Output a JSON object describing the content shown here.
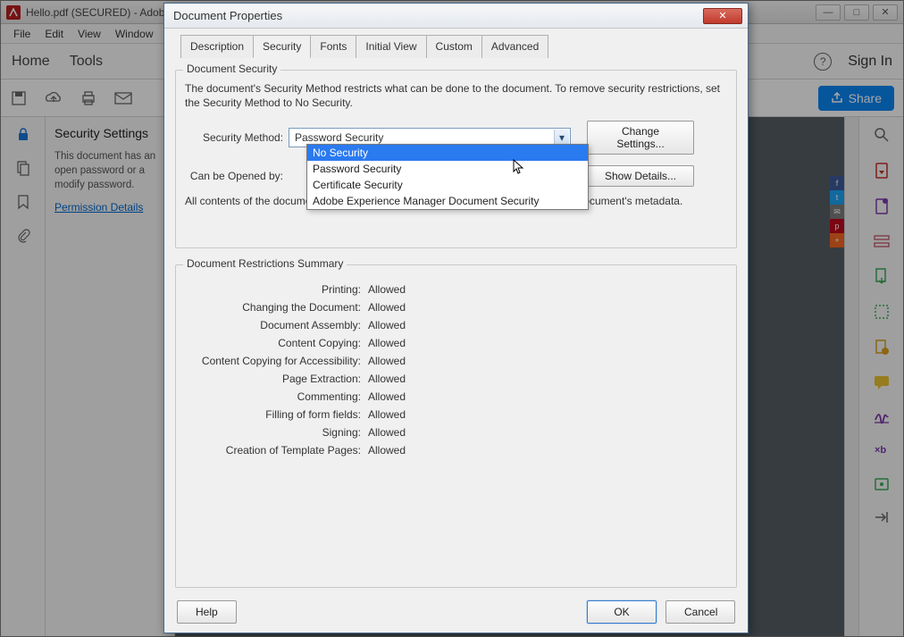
{
  "app": {
    "title": "Hello.pdf (SECURED) - Adob…",
    "menubar": [
      "File",
      "Edit",
      "View",
      "Window"
    ],
    "tabs": {
      "home": "Home",
      "tools": "Tools"
    },
    "help_glyph": "?",
    "signin": "Sign In",
    "share": "Share"
  },
  "leftpanel": {
    "heading": "Security Settings",
    "desc": "This document has an open password or a modify password.",
    "link": "Permission Details"
  },
  "dialog": {
    "title": "Document Properties",
    "tabs": [
      "Description",
      "Security",
      "Fonts",
      "Initial View",
      "Custom",
      "Advanced"
    ],
    "active_tab": 1,
    "security": {
      "group_label": "Document Security",
      "intro": "The document's Security Method restricts what can be done to the document. To remove security restrictions, set the Security Method to No Security.",
      "method_label": "Security Method:",
      "method_value": "Password Security",
      "method_options": [
        "No Security",
        "Password Security",
        "Certificate Security",
        "Adobe Experience Manager Document Security"
      ],
      "method_selected_index": 0,
      "change_settings": "Change Settings...",
      "opened_by_label": "Can be Opened by:",
      "show_details": "Show Details...",
      "contents_note": "All contents of the document are encrypted and search engines cannot access the document's metadata."
    },
    "restrictions": {
      "group_label": "Document Restrictions Summary",
      "items": [
        {
          "label": "Printing:",
          "value": "Allowed"
        },
        {
          "label": "Changing the Document:",
          "value": "Allowed"
        },
        {
          "label": "Document Assembly:",
          "value": "Allowed"
        },
        {
          "label": "Content Copying:",
          "value": "Allowed"
        },
        {
          "label": "Content Copying for Accessibility:",
          "value": "Allowed"
        },
        {
          "label": "Page Extraction:",
          "value": "Allowed"
        },
        {
          "label": "Commenting:",
          "value": "Allowed"
        },
        {
          "label": "Filling of form fields:",
          "value": "Allowed"
        },
        {
          "label": "Signing:",
          "value": "Allowed"
        },
        {
          "label": "Creation of Template Pages:",
          "value": "Allowed"
        }
      ]
    },
    "footer": {
      "help": "Help",
      "ok": "OK",
      "cancel": "Cancel"
    }
  }
}
